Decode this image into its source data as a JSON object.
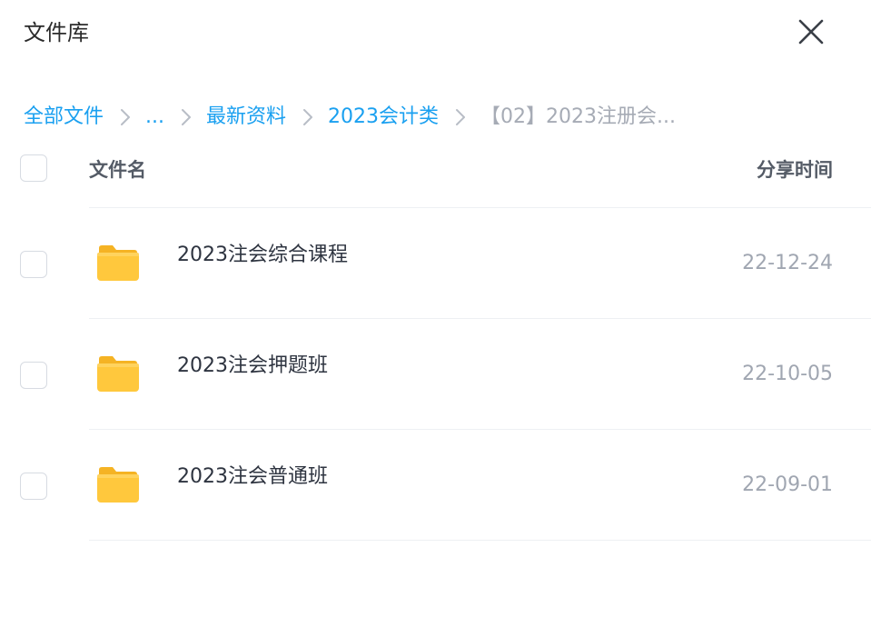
{
  "dialog": {
    "title": "文件库",
    "close_icon": "close-icon"
  },
  "breadcrumb": {
    "items": [
      {
        "label": "全部文件",
        "current": false
      },
      {
        "label": "...",
        "current": false
      },
      {
        "label": "最新资料",
        "current": false
      },
      {
        "label": "2023会计类",
        "current": false
      },
      {
        "label": "【02】2023注册会...",
        "current": true
      }
    ],
    "separator_icon": "chevron-right-icon"
  },
  "table": {
    "headers": {
      "name": "文件名",
      "time": "分享时间"
    },
    "rows": [
      {
        "icon": "folder-icon",
        "name": "2023注会综合课程",
        "date": "22-12-24"
      },
      {
        "icon": "folder-icon",
        "name": "2023注会押题班",
        "date": "22-10-05"
      },
      {
        "icon": "folder-icon",
        "name": "2023注会普通班",
        "date": "22-09-01"
      }
    ]
  },
  "colors": {
    "link": "#1aa0f0",
    "current_crumb": "#a6abb5",
    "folder": "#ffc83d",
    "date": "#a0a6b1"
  }
}
